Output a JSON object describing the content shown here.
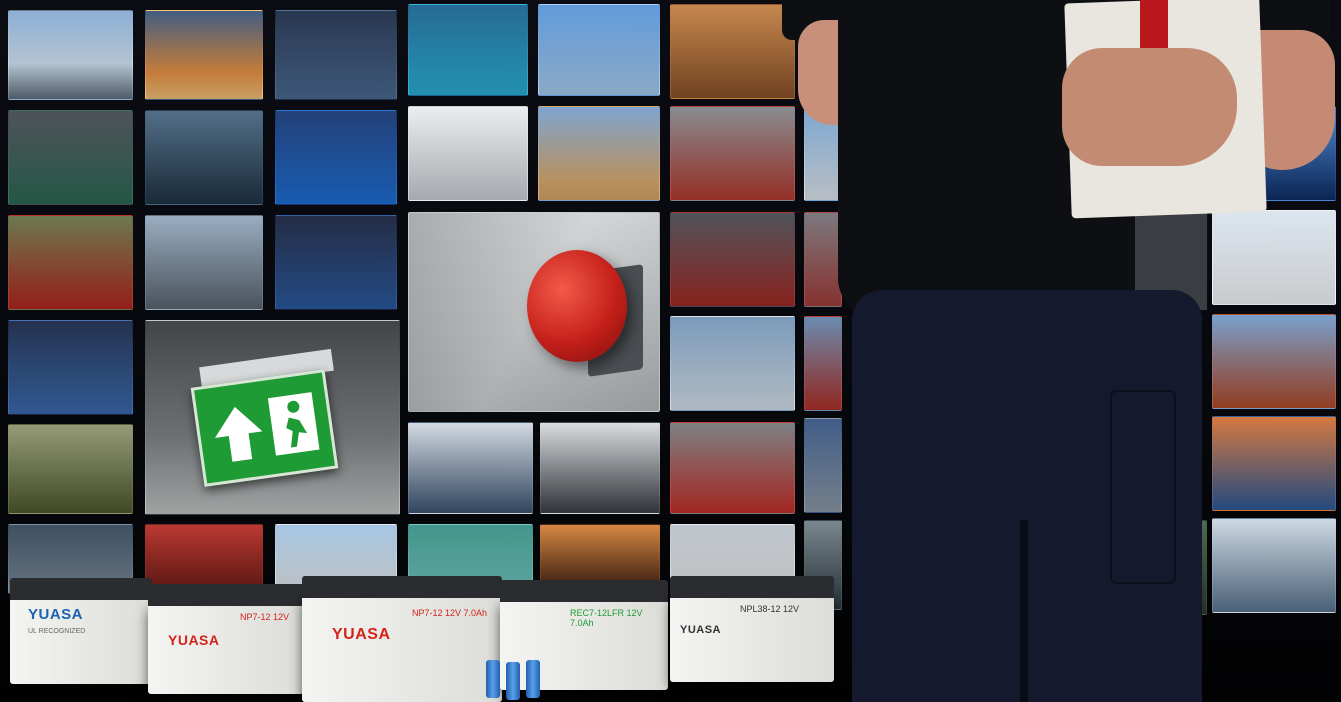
{
  "scene": {
    "colors": {
      "background": "#05060a",
      "exit_sign_green": "#1e9b35",
      "bell_red": "#c4201a",
      "shirt_black": "#0d0f12",
      "trousers_navy": "#14192d",
      "yuasa_red": "#d4231b",
      "yuasa_blue": "#1a64b4"
    }
  },
  "batteries": [
    {
      "brand": "YUASA",
      "model": "",
      "brand_color": "#1a64b4"
    },
    {
      "brand": "YUASA",
      "model": "NP7-12  12V",
      "brand_color": "#d4231b"
    },
    {
      "brand": "YUASA",
      "model": "NP7-12  12V 7.0Ah",
      "brand_color": "#d4231b"
    },
    {
      "brand": "",
      "model": "REC7-12LFR  12V 7.0Ah",
      "brand_color": "#1e9b35"
    },
    {
      "brand": "YUASA",
      "model": "NPL38-12  12V",
      "brand_color": "#333333"
    }
  ]
}
